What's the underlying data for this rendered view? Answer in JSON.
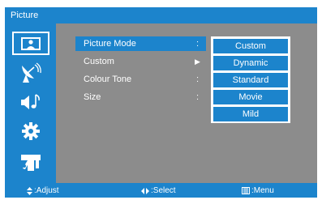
{
  "window": {
    "title": "Picture"
  },
  "sidebar": {
    "items": [
      {
        "icon": "picture-icon",
        "active": true
      },
      {
        "icon": "satellite-dish-icon",
        "active": false
      },
      {
        "icon": "sound-icon",
        "active": false
      },
      {
        "icon": "settings-gear-icon",
        "active": false
      },
      {
        "icon": "parental-lock-icon",
        "active": false
      }
    ]
  },
  "menu": {
    "items": [
      {
        "label": "Picture Mode",
        "mark": ":"
      },
      {
        "label": "Custom",
        "mark": "▶"
      },
      {
        "label": "Colour Tone",
        "mark": ":"
      },
      {
        "label": "Size",
        "mark": ":"
      }
    ]
  },
  "dropdown": {
    "options": [
      "Custom",
      "Dynamic",
      "Standard",
      "Movie",
      "Mild"
    ]
  },
  "footer": {
    "adjust": ":Adjust",
    "select": ":Select",
    "menu": ":Menu"
  },
  "colors": {
    "accent": "#1c84cc",
    "panel": "#8c8c8c"
  }
}
